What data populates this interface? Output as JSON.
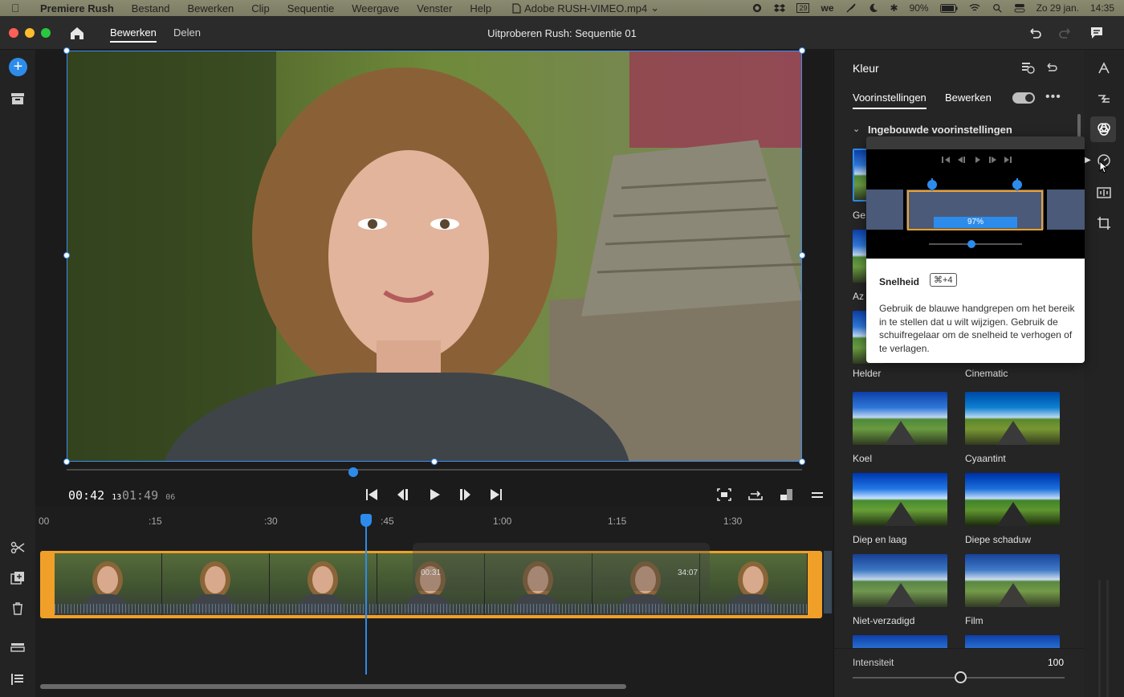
{
  "menubar": {
    "app_name": "Premiere Rush",
    "items": [
      "Bestand",
      "Bewerken",
      "Clip",
      "Sequentie",
      "Weergave",
      "Venster",
      "Help"
    ],
    "open_file": "Adobe RUSH-VIMEO.mp4",
    "battery": "90%",
    "datetime_day": "Zo 29 jan.",
    "datetime_time": "14:35",
    "calendar_day": "29"
  },
  "titlebar": {
    "tabs": [
      "Bewerken",
      "Delen"
    ],
    "title": "Uitproberen Rush: Sequentie 01"
  },
  "player": {
    "current_time": "00:42",
    "current_frames": "13",
    "duration": "01:49",
    "duration_frames": "06",
    "scrub_position_fraction": 0.39
  },
  "timeline": {
    "ruler_labels": [
      "00",
      ":15",
      ":30",
      ":45",
      "1:00",
      "1:15",
      "1:30"
    ],
    "overlay_times": [
      "00:31",
      "34:07"
    ]
  },
  "panel": {
    "title": "Kleur",
    "tabs": [
      "Voorinstellingen",
      "Bewerken"
    ],
    "section_title": "Ingebouwde voorinstellingen",
    "presets_partial": [
      "Ge",
      "Az"
    ],
    "presets": [
      "Helder",
      "Cinematic",
      "Koel",
      "Cyaantint",
      "Diep en laag",
      "Diepe schaduw",
      "Niet-verzadigd",
      "Film"
    ],
    "intensity_label": "Intensiteit",
    "intensity_value": "100"
  },
  "tooltip": {
    "heading": "Snelheid",
    "shortcut": "⌘+4",
    "percent": "97%",
    "body": "Gebruik de blauwe handgrepen om het bereik in te stellen dat u wilt wijzigen. Gebruik de schuifregelaar om de snelheid te verhogen of te verlagen."
  },
  "colors": {
    "accent": "#2d8ceb",
    "clip_border": "#f0a028",
    "panel_bg": "#252525"
  }
}
